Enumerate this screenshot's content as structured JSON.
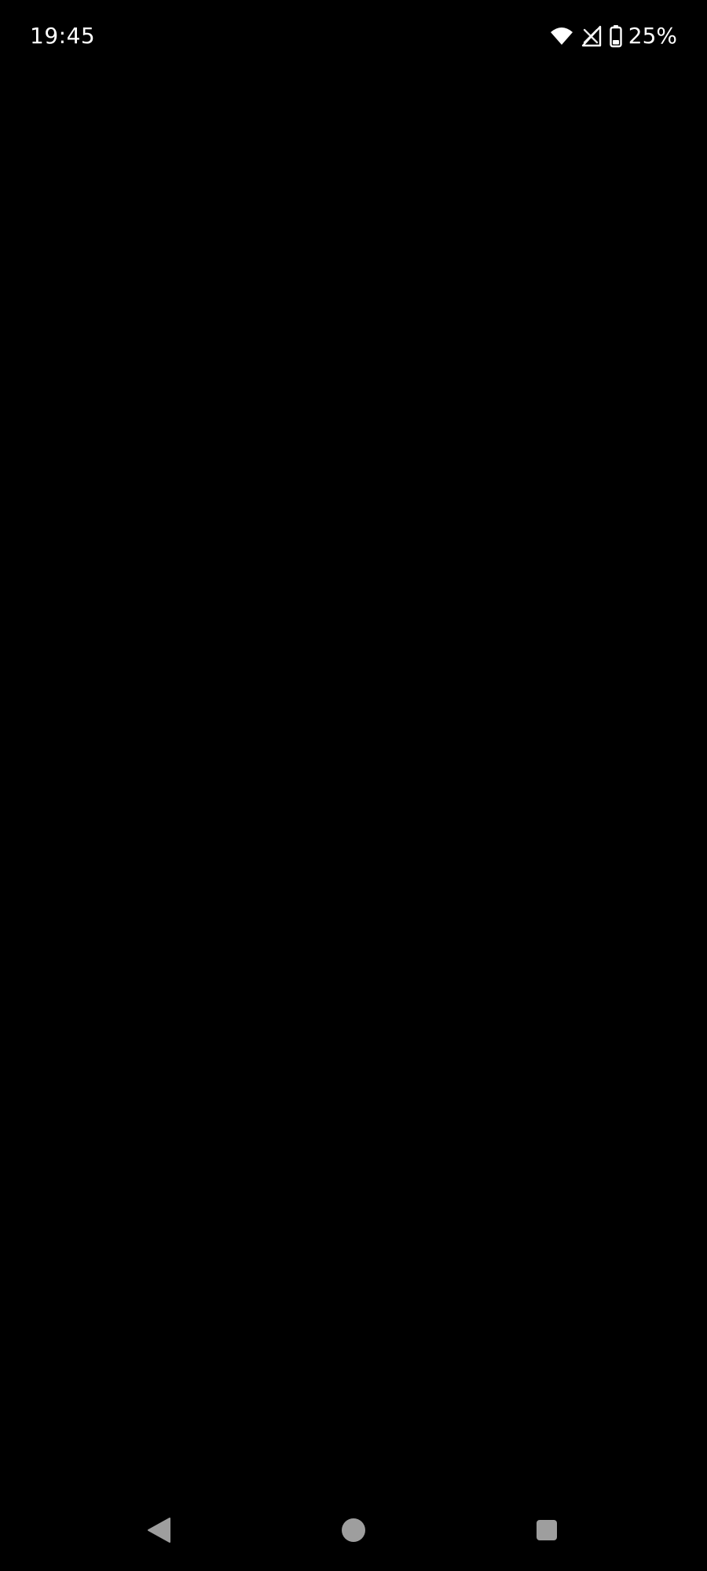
{
  "status_bar": {
    "time": "19:45",
    "battery_percent": "25%",
    "icons": [
      "wifi-icon",
      "cellular-signal-icon",
      "battery-icon"
    ]
  },
  "navigation_bar": {
    "buttons": [
      "back-icon",
      "home-icon",
      "recents-icon"
    ]
  },
  "colors": {
    "background": "#000000",
    "status_text": "#ffffff",
    "nav_icon": "#9e9e9e"
  }
}
